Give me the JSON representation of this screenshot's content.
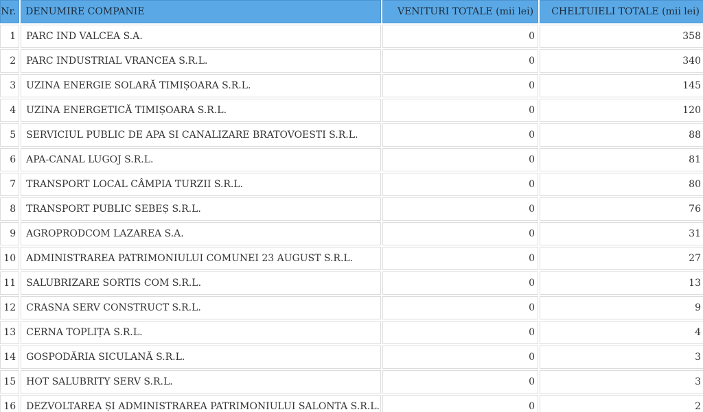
{
  "table": {
    "headers": {
      "nr": "Nr.",
      "name": "DENUMIRE COMPANIE",
      "venituri": "VENITURI TOTALE (mii lei)",
      "cheltuieli": "CHELTUIELI TOTALE (mii lei)"
    },
    "rows": [
      {
        "nr": "1",
        "name": "PARC IND VALCEA S.A.",
        "venituri": "0",
        "cheltuieli": "358"
      },
      {
        "nr": "2",
        "name": "PARC INDUSTRIAL VRANCEA S.R.L.",
        "venituri": "0",
        "cheltuieli": "340"
      },
      {
        "nr": "3",
        "name": "UZINA ENERGIE SOLARĂ TIMIȘOARA S.R.L.",
        "venituri": "0",
        "cheltuieli": "145"
      },
      {
        "nr": "4",
        "name": "UZINA ENERGETICĂ TIMIȘOARA S.R.L.",
        "venituri": "0",
        "cheltuieli": "120"
      },
      {
        "nr": "5",
        "name": "SERVICIUL PUBLIC DE APA SI CANALIZARE BRATOVOESTI S.R.L.",
        "venituri": "0",
        "cheltuieli": "88"
      },
      {
        "nr": "6",
        "name": "APA-CANAL LUGOJ S.R.L.",
        "venituri": "0",
        "cheltuieli": "81"
      },
      {
        "nr": "7",
        "name": "TRANSPORT LOCAL CÂMPIA TURZII S.R.L.",
        "venituri": "0",
        "cheltuieli": "80"
      },
      {
        "nr": "8",
        "name": "TRANSPORT PUBLIC SEBEȘ S.R.L.",
        "venituri": "0",
        "cheltuieli": "76"
      },
      {
        "nr": "9",
        "name": "AGROPRODCOM LAZAREA S.A.",
        "venituri": "0",
        "cheltuieli": "31"
      },
      {
        "nr": "10",
        "name": "ADMINISTRAREA PATRIMONIULUI COMUNEI 23 AUGUST S.R.L.",
        "venituri": "0",
        "cheltuieli": "27"
      },
      {
        "nr": "11",
        "name": "SALUBRIZARE SORTIS COM S.R.L.",
        "venituri": "0",
        "cheltuieli": "13"
      },
      {
        "nr": "12",
        "name": "CRASNA SERV CONSTRUCT S.R.L.",
        "venituri": "0",
        "cheltuieli": "9"
      },
      {
        "nr": "13",
        "name": "CERNA TOPLIȚA S.R.L.",
        "venituri": "0",
        "cheltuieli": "4"
      },
      {
        "nr": "14",
        "name": "GOSPODĂRIA SICULANĂ S.R.L.",
        "venituri": "0",
        "cheltuieli": "3"
      },
      {
        "nr": "15",
        "name": "HOT SALUBRITY SERV S.R.L.",
        "venituri": "0",
        "cheltuieli": "3"
      },
      {
        "nr": "16",
        "name": "DEZVOLTAREA ȘI ADMINISTRAREA PATRIMONIULUI SALONTA S.R.L.",
        "venituri": "0",
        "cheltuieli": "2"
      }
    ]
  },
  "colors": {
    "header_bg": "#5aa9e6",
    "cell_border": "#dcdcdc"
  }
}
